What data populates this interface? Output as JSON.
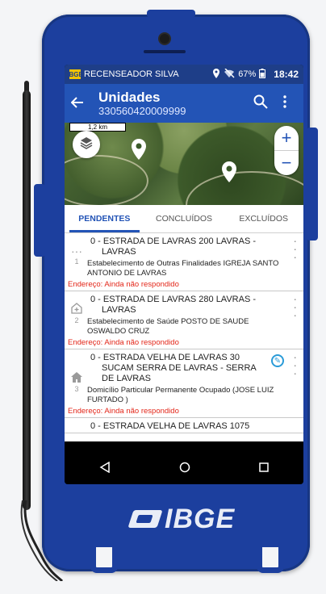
{
  "status_bar": {
    "app_name": "RECENSEADOR SILVA",
    "battery": "67%",
    "time": "18:42"
  },
  "header": {
    "title": "Unidades",
    "subtitle": "330560420009999"
  },
  "map": {
    "scale_label": "1,2 km",
    "zoom_in": "+",
    "zoom_out": "−"
  },
  "tabs": [
    {
      "label": "PENDENTES"
    },
    {
      "label": "CONCLUÍDOS"
    },
    {
      "label": "EXCLUÍDOS"
    }
  ],
  "units": [
    {
      "number": "1",
      "address_line1": "0 - ESTRADA DE LAVRAS 200 LAVRAS -",
      "address_line2": "LAVRAS",
      "description": "Estabelecimento de Outras Finalidades IGREJA SANTO ANTONIO DE LAVRAS",
      "status": "Endereço: Ainda não respondido"
    },
    {
      "number": "2",
      "address_line1": "0 - ESTRADA DE LAVRAS 280 LAVRAS -",
      "address_line2": "LAVRAS",
      "description": "Estabelecimento de Saúde POSTO DE SAUDE OSWALDO CRUZ",
      "status": "Endereço: Ainda não respondido"
    },
    {
      "number": "3",
      "address_line1": "0 - ESTRADA VELHA DE LAVRAS 30",
      "address_line2": "SUCAM SERRA DE LAVRAS - SERRA DE LAVRAS",
      "description": "Domicílio Particular Permanente Ocupado (JOSE LUIZ FURTADO )",
      "status": "Endereço: Ainda não respondido"
    }
  ],
  "partial_item": "0 - ESTRADA VELHA DE LAVRAS 1075",
  "device_logo": "IBGE"
}
